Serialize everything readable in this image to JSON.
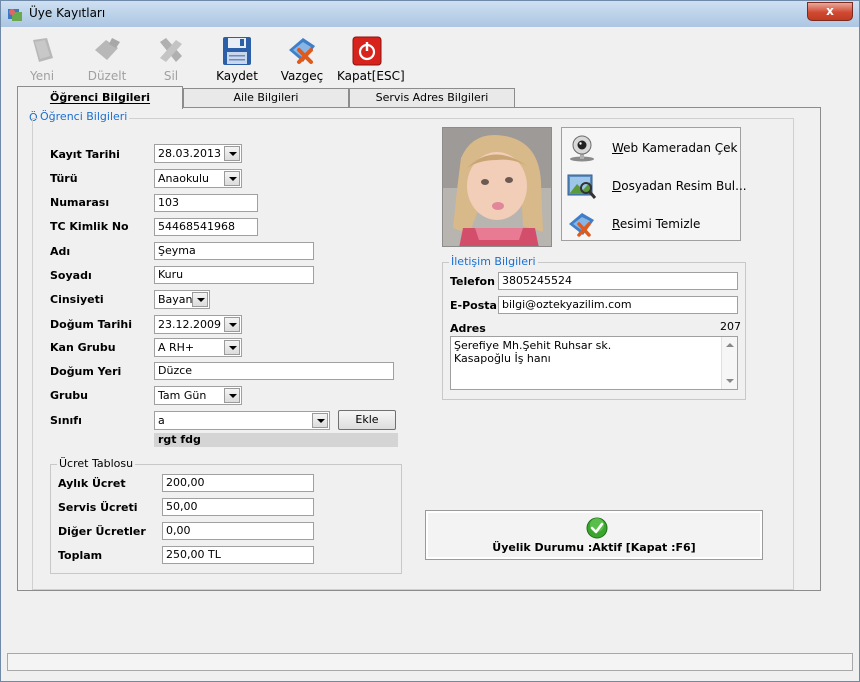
{
  "window": {
    "title": "Üye Kayıtları",
    "close_label": "x"
  },
  "toolbar": {
    "yeni": "Yeni",
    "duzelt": "Düzelt",
    "sil": "Sil",
    "kaydet": "Kaydet",
    "vazgec": "Vazgeç",
    "kapat": "Kapat[ESC]"
  },
  "tabs": [
    {
      "label": "Öğrenci Bilgileri",
      "active": true
    },
    {
      "label": "Aile Bilgileri",
      "active": false
    },
    {
      "label": "Servis Adres Bilgileri",
      "active": false
    }
  ],
  "ogrenci": {
    "group_title": "Öğrenci Bilgileri",
    "kayit_tarihi_label": "Kayıt Tarihi",
    "kayit_tarihi": "28.03.2013",
    "turu_label": "Türü",
    "turu": "Anaokulu",
    "numarasi_label": "Numarası",
    "numarasi": "103",
    "tc_label": "TC Kimlik No",
    "tc": "54468541968",
    "adi_label": "Adı",
    "adi": "Şeyma",
    "soyadi_label": "Soyadı",
    "soyadi": "Kuru",
    "cinsiyeti_label": "Cinsiyeti",
    "cinsiyeti": "Bayan",
    "dogum_tarihi_label": "Doğum Tarihi",
    "dogum_tarihi": "23.12.2009",
    "kan_grubu_label": "Kan Grubu",
    "kan_grubu": "A RH+",
    "dogum_yeri_label": "Doğum Yeri",
    "dogum_yeri": "Düzce",
    "grubu_label": "Grubu",
    "grubu": "Tam Gün",
    "sinifi_label": "Sınıfı",
    "sinifi": "a",
    "sinif_aciklama": "rgt fdg",
    "ekle_label": "Ekle"
  },
  "ucret": {
    "group_title": "Ücret Tablosu",
    "aylik_label": "Aylık Ücret",
    "aylik": "200,00",
    "servis_label": "Servis Ücreti",
    "servis": "50,00",
    "diger_label": "Diğer Ücretler",
    "diger": "0,00",
    "toplam_label": "Toplam",
    "toplam": "250,00 TL"
  },
  "foto": {
    "webcam_prefix": "W",
    "webcam_rest": "eb Kameradan Çek",
    "dosya_prefix": "D",
    "dosya_rest": "osyadan Resim Bul...",
    "temizle_prefix": "R",
    "temizle_rest": "esimi Temizle"
  },
  "iletisim": {
    "group_title": "İletişim Bilgileri",
    "telefon_label": "Telefon",
    "telefon": "3805245524",
    "eposta_label": "E-Posta",
    "eposta": "bilgi@oztekyazilim.com",
    "adres_label": "Adres",
    "adres_count": "207",
    "adres_line1": "Şerefiye Mh.Şehit Ruhsar sk.",
    "adres_line2": "Kasapoğlu İş hanı"
  },
  "status": {
    "text": "Üyelik Durumu :Aktif [Kapat :F6]"
  },
  "colors": {
    "accent": "#1a6fcf",
    "titlebar": "#b9d0e8",
    "close": "#c23a22"
  }
}
